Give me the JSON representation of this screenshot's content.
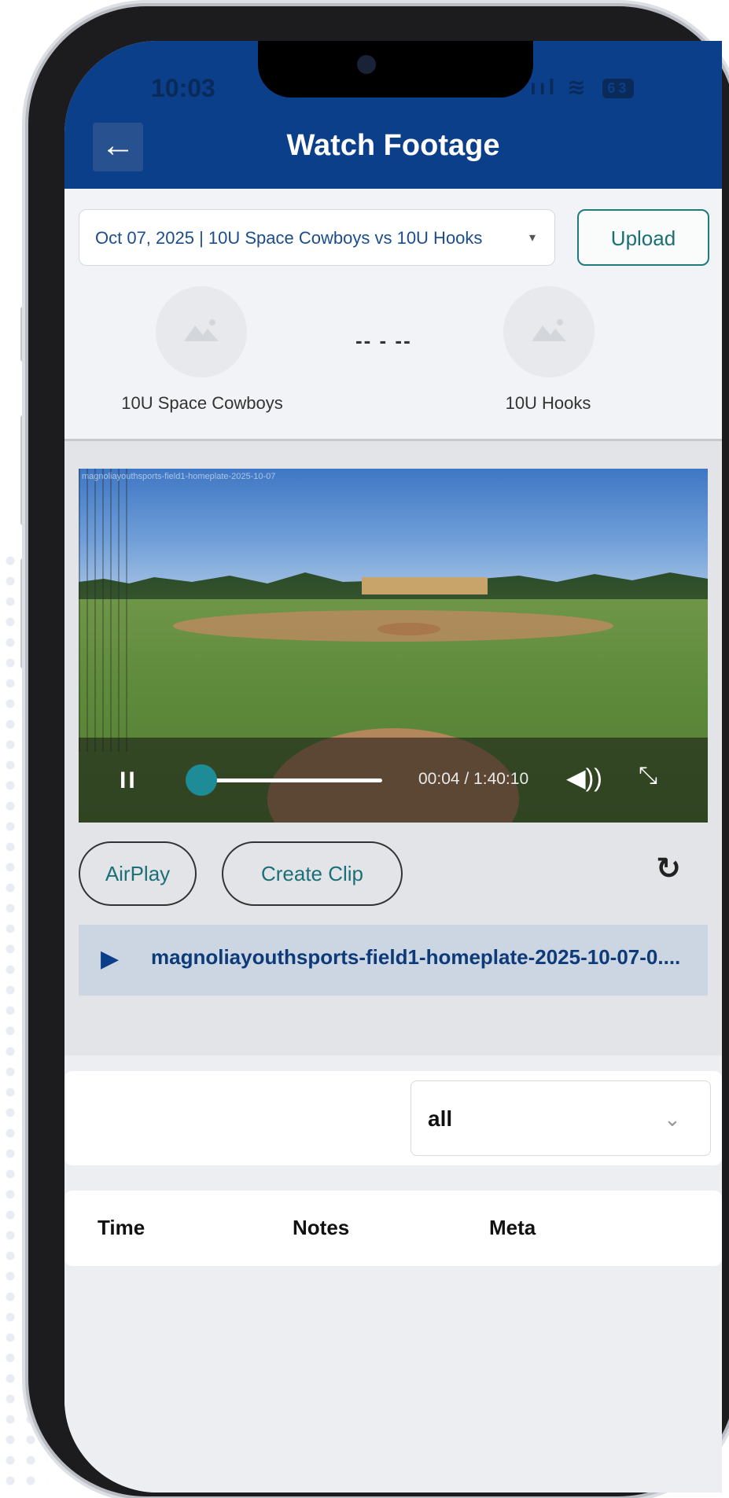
{
  "status_bar": {
    "time": "10:03",
    "signal": "ııl",
    "wifi": "≋",
    "battery": "63"
  },
  "header": {
    "back_icon": "←",
    "title": "Watch Footage"
  },
  "game": {
    "selected": "Oct 07, 2025 | 10U Space Cowboys vs 10U Hooks",
    "caret": "▾",
    "upload_label": "Upload",
    "home_team": "10U Space Cowboys",
    "away_team": "10U Hooks",
    "score": "-- - --"
  },
  "video": {
    "overlay_text": "magnoliayouthsports-field1-homeplate-2025-10-07",
    "pause_icon": "II",
    "timecode": "00:04 / 1:40:10",
    "progress_fraction": 0.0007,
    "volume_icon": "◀))",
    "fullscreen_icon": "⤡"
  },
  "actions": {
    "airplay_label": "AirPlay",
    "create_clip_label": "Create Clip",
    "refresh_icon": "↻"
  },
  "file": {
    "play_icon": "▶",
    "name": "magnoliayouthsports-field1-homeplate-2025-10-07-0...."
  },
  "filter": {
    "value": "all",
    "chevron": "⌄"
  },
  "table": {
    "columns": [
      "Time",
      "Notes",
      "Meta"
    ]
  },
  "colors": {
    "header_bg": "#0b3f8a",
    "accent_teal": "#1d8c96",
    "file_row_bg": "#ccd6e3"
  }
}
